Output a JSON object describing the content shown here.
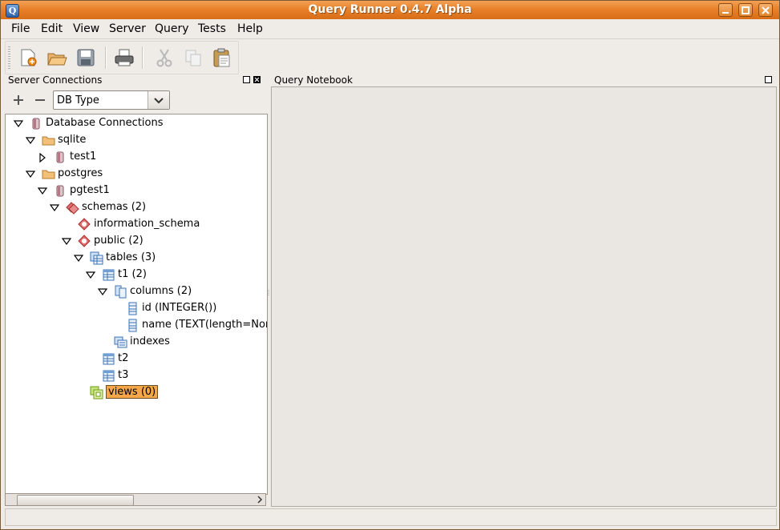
{
  "window": {
    "title": "Query Runner 0.4.7 Alpha",
    "app_icon": "Q"
  },
  "menu": [
    "File",
    "Edit",
    "View",
    "Server",
    "Query",
    "Tests",
    "Help"
  ],
  "toolbar": {
    "buttons": [
      "new-icon",
      "open-icon",
      "save-icon",
      "print-icon",
      "cut-icon",
      "copy-icon",
      "paste-icon"
    ]
  },
  "server_connections": {
    "title": "Server Connections",
    "db_type": "DB Type",
    "tree": [
      {
        "label": "Database Connections",
        "icon": "database-icon",
        "expanded": true
      },
      {
        "label": "sqlite",
        "icon": "folder-icon",
        "expanded": true
      },
      {
        "label": "test1",
        "icon": "database-icon",
        "expanded": false
      },
      {
        "label": "postgres",
        "icon": "folder-icon",
        "expanded": true
      },
      {
        "label": "pgtest1",
        "icon": "database-icon",
        "expanded": true
      },
      {
        "label": "schemas (2)",
        "icon": "schemas-icon",
        "expanded": true
      },
      {
        "label": "information_schema",
        "icon": "schema-icon"
      },
      {
        "label": "public (2)",
        "icon": "schema-icon",
        "expanded": true
      },
      {
        "label": "tables (3)",
        "icon": "tables-icon",
        "expanded": true
      },
      {
        "label": "t1 (2)",
        "icon": "table-icon",
        "expanded": true
      },
      {
        "label": "columns (2)",
        "icon": "columns-icon",
        "expanded": true
      },
      {
        "label": "id (INTEGER())",
        "icon": "column-icon"
      },
      {
        "label": "name (TEXT(length=Nor",
        "icon": "column-icon"
      },
      {
        "label": "indexes",
        "icon": "indexes-icon"
      },
      {
        "label": "t2",
        "icon": "table-icon"
      },
      {
        "label": "t3",
        "icon": "table-icon"
      },
      {
        "label": "views (0)",
        "icon": "views-icon",
        "selected": true
      }
    ]
  },
  "query_notebook": {
    "title": "Query Notebook"
  }
}
